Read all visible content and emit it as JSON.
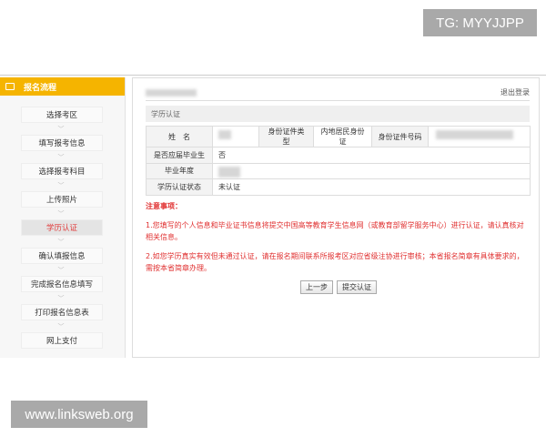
{
  "watermarks": {
    "top": "TG: MYYJJPP",
    "bottom": "www.linksweb.org"
  },
  "sidebar": {
    "title": "报名流程",
    "icon": "monitor-icon",
    "active_color": "#e03c3c",
    "header_color": "#f5b400",
    "steps": [
      {
        "label": "选择考区"
      },
      {
        "label": "填写报考信息"
      },
      {
        "label": "选择报考科目"
      },
      {
        "label": "上传照片"
      },
      {
        "label": "学历认证",
        "active": true
      },
      {
        "label": "确认填报信息"
      },
      {
        "label": "完成报名信息填写"
      },
      {
        "label": "打印报名信息表"
      },
      {
        "label": "网上支付"
      }
    ]
  },
  "header": {
    "logout": "退出登录"
  },
  "section": {
    "title": "学历认证"
  },
  "table": {
    "name_label": "姓　名",
    "id_type_label": "身份证件类型",
    "id_type_value": "内地居民身份证",
    "id_no_label": "身份证件号码",
    "fresh_grad_label": "是否应届毕业生",
    "fresh_grad_value": "否",
    "grad_year_label": "毕业年度",
    "status_label": "学历认证状态",
    "status_value": "未认证"
  },
  "notice": {
    "title": "注意事项：",
    "items": [
      "1.您填写的个人信息和毕业证书信息将提交中国高等教育学生信息网（或教育部留学服务中心）进行认证，请认真核对相关信息。",
      "2.如您学历真实有效但未通过认证，请在报名期间联系所报考区对应省级注协进行审核；本省报名简章有具体要求的，需按本省简章办理。"
    ]
  },
  "buttons": {
    "prev": "上一步",
    "submit": "提交认证"
  }
}
